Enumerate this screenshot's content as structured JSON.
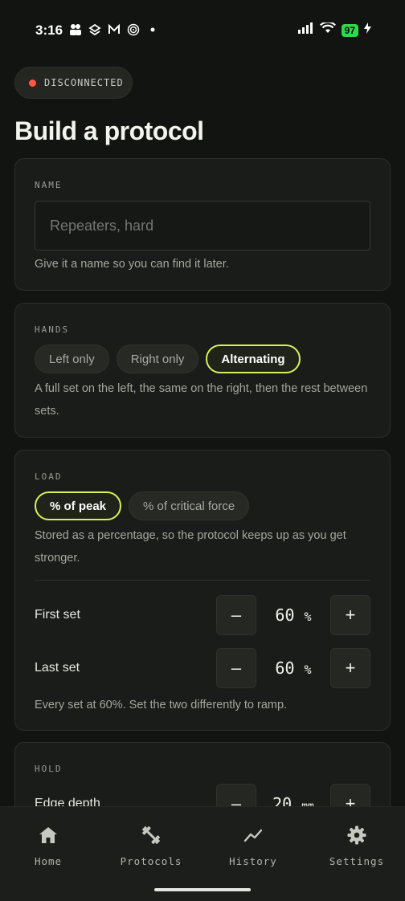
{
  "status_bar": {
    "time": "3:16",
    "left_icons": [
      "people-icon",
      "stack-icon",
      "gmail-icon",
      "target-icon",
      "dot-icon"
    ],
    "battery": "97"
  },
  "connection": {
    "status": "DISCONNECTED",
    "color": "#ff5a44"
  },
  "page_title": "Build a protocol",
  "name_card": {
    "label": "NAME",
    "placeholder": "Repeaters, hard",
    "help": "Give it a name so you can find it later."
  },
  "hands_card": {
    "label": "HANDS",
    "options": [
      "Left only",
      "Right only",
      "Alternating"
    ],
    "selected": "Alternating",
    "help": "A full set on the left, the same on the right, then the rest between sets."
  },
  "load_card": {
    "label": "LOAD",
    "options": [
      "% of peak",
      "% of critical force"
    ],
    "selected": "% of peak",
    "help": "Stored as a percentage, so the protocol keeps up as you get stronger.",
    "first_set": {
      "label": "First set",
      "value": "60",
      "unit": "%"
    },
    "last_set": {
      "label": "Last set",
      "value": "60",
      "unit": "%"
    },
    "minus": "–",
    "plus": "+",
    "footer": "Every set at 60%. Set the two differently to ramp."
  },
  "hold_card": {
    "label": "HOLD",
    "edge_depth": {
      "label": "Edge depth",
      "value": "20",
      "unit": "mm"
    }
  },
  "tab_bar": {
    "tabs": [
      {
        "label": "Home",
        "icon": "home-icon"
      },
      {
        "label": "Protocols",
        "icon": "dumbbell-icon"
      },
      {
        "label": "History",
        "icon": "chart-line-icon"
      },
      {
        "label": "Settings",
        "icon": "gear-icon"
      }
    ]
  },
  "colors": {
    "accent": "#d6f25a",
    "background": "#121411",
    "card": "#1a1c19"
  }
}
